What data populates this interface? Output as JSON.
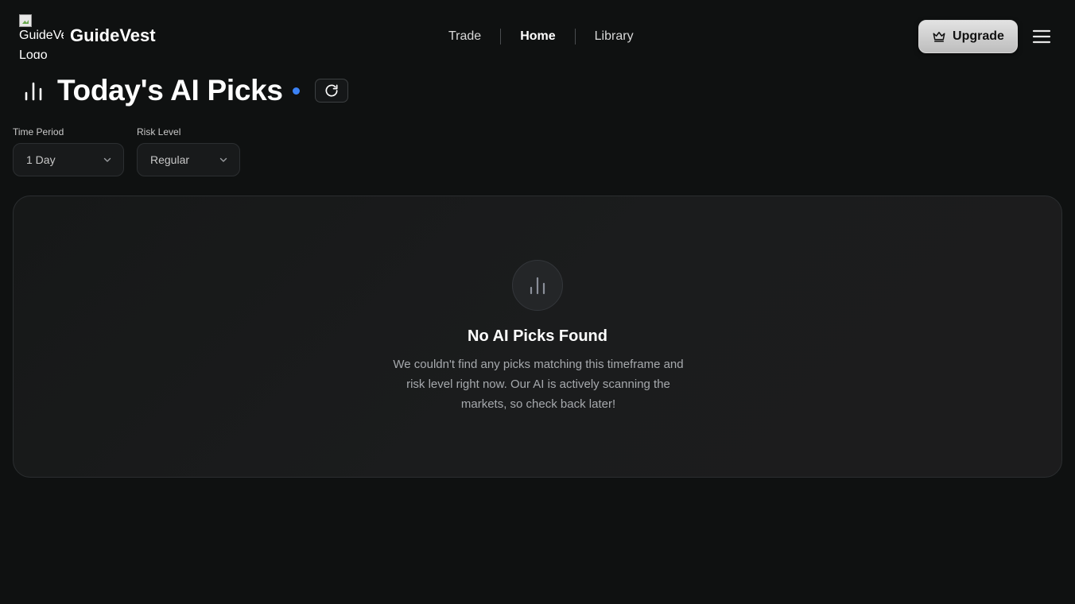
{
  "header": {
    "logo_alt": "GuideVest Logo",
    "brand": "GuideVest",
    "nav": [
      {
        "label": "Trade",
        "active": false
      },
      {
        "label": "Home",
        "active": true
      },
      {
        "label": "Library",
        "active": false
      }
    ],
    "upgrade_label": "Upgrade"
  },
  "page": {
    "title": "Today's AI Picks",
    "live_dot_color": "#3b82f6"
  },
  "filters": {
    "time_period": {
      "label": "Time Period",
      "value": "1 Day"
    },
    "risk_level": {
      "label": "Risk Level",
      "value": "Regular"
    }
  },
  "empty_state": {
    "title": "No AI Picks Found",
    "description": "We couldn't find any picks matching this timeframe and risk level right now. Our AI is actively scanning the markets, so check back later!"
  },
  "icons": {
    "title": "bar-chart-icon",
    "refresh": "refresh-icon",
    "upgrade": "crown-icon",
    "menu": "hamburger-menu-icon",
    "empty": "bar-chart-icon",
    "select": "chevron-down-icon"
  },
  "colors": {
    "background": "#0f1111",
    "accent": "#3b82f6"
  }
}
